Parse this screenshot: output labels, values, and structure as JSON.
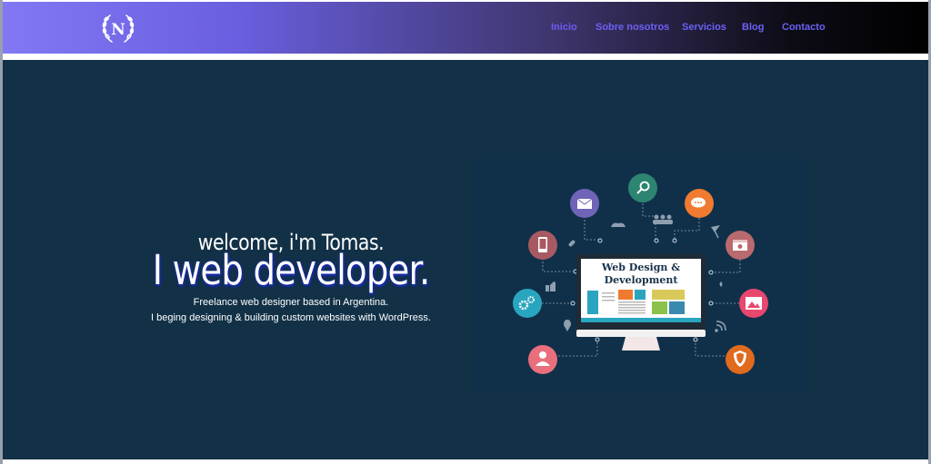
{
  "header": {
    "logo_letter": "N",
    "nav": [
      {
        "label": "Inicio",
        "color": "#6b5cf0",
        "active": true
      },
      {
        "label": "Sobre nosotros",
        "color": "#5b4ff0"
      },
      {
        "label": "Servicios",
        "color": "#5b4ff0"
      },
      {
        "label": "Blog",
        "color": "#5b4ff0"
      },
      {
        "label": "Contacto",
        "color": "#5b4ff0"
      }
    ]
  },
  "hero": {
    "welcome": "welcome, i'm Tomas.",
    "headline": "I web developer.",
    "sub1": "Freelance web designer based in Argentina.",
    "sub2": "I beging designing & building custom websites with WordPress.",
    "background": "#123147"
  },
  "illustration": {
    "screen_title_line1": "Web Design &",
    "screen_title_line2": "Development"
  }
}
